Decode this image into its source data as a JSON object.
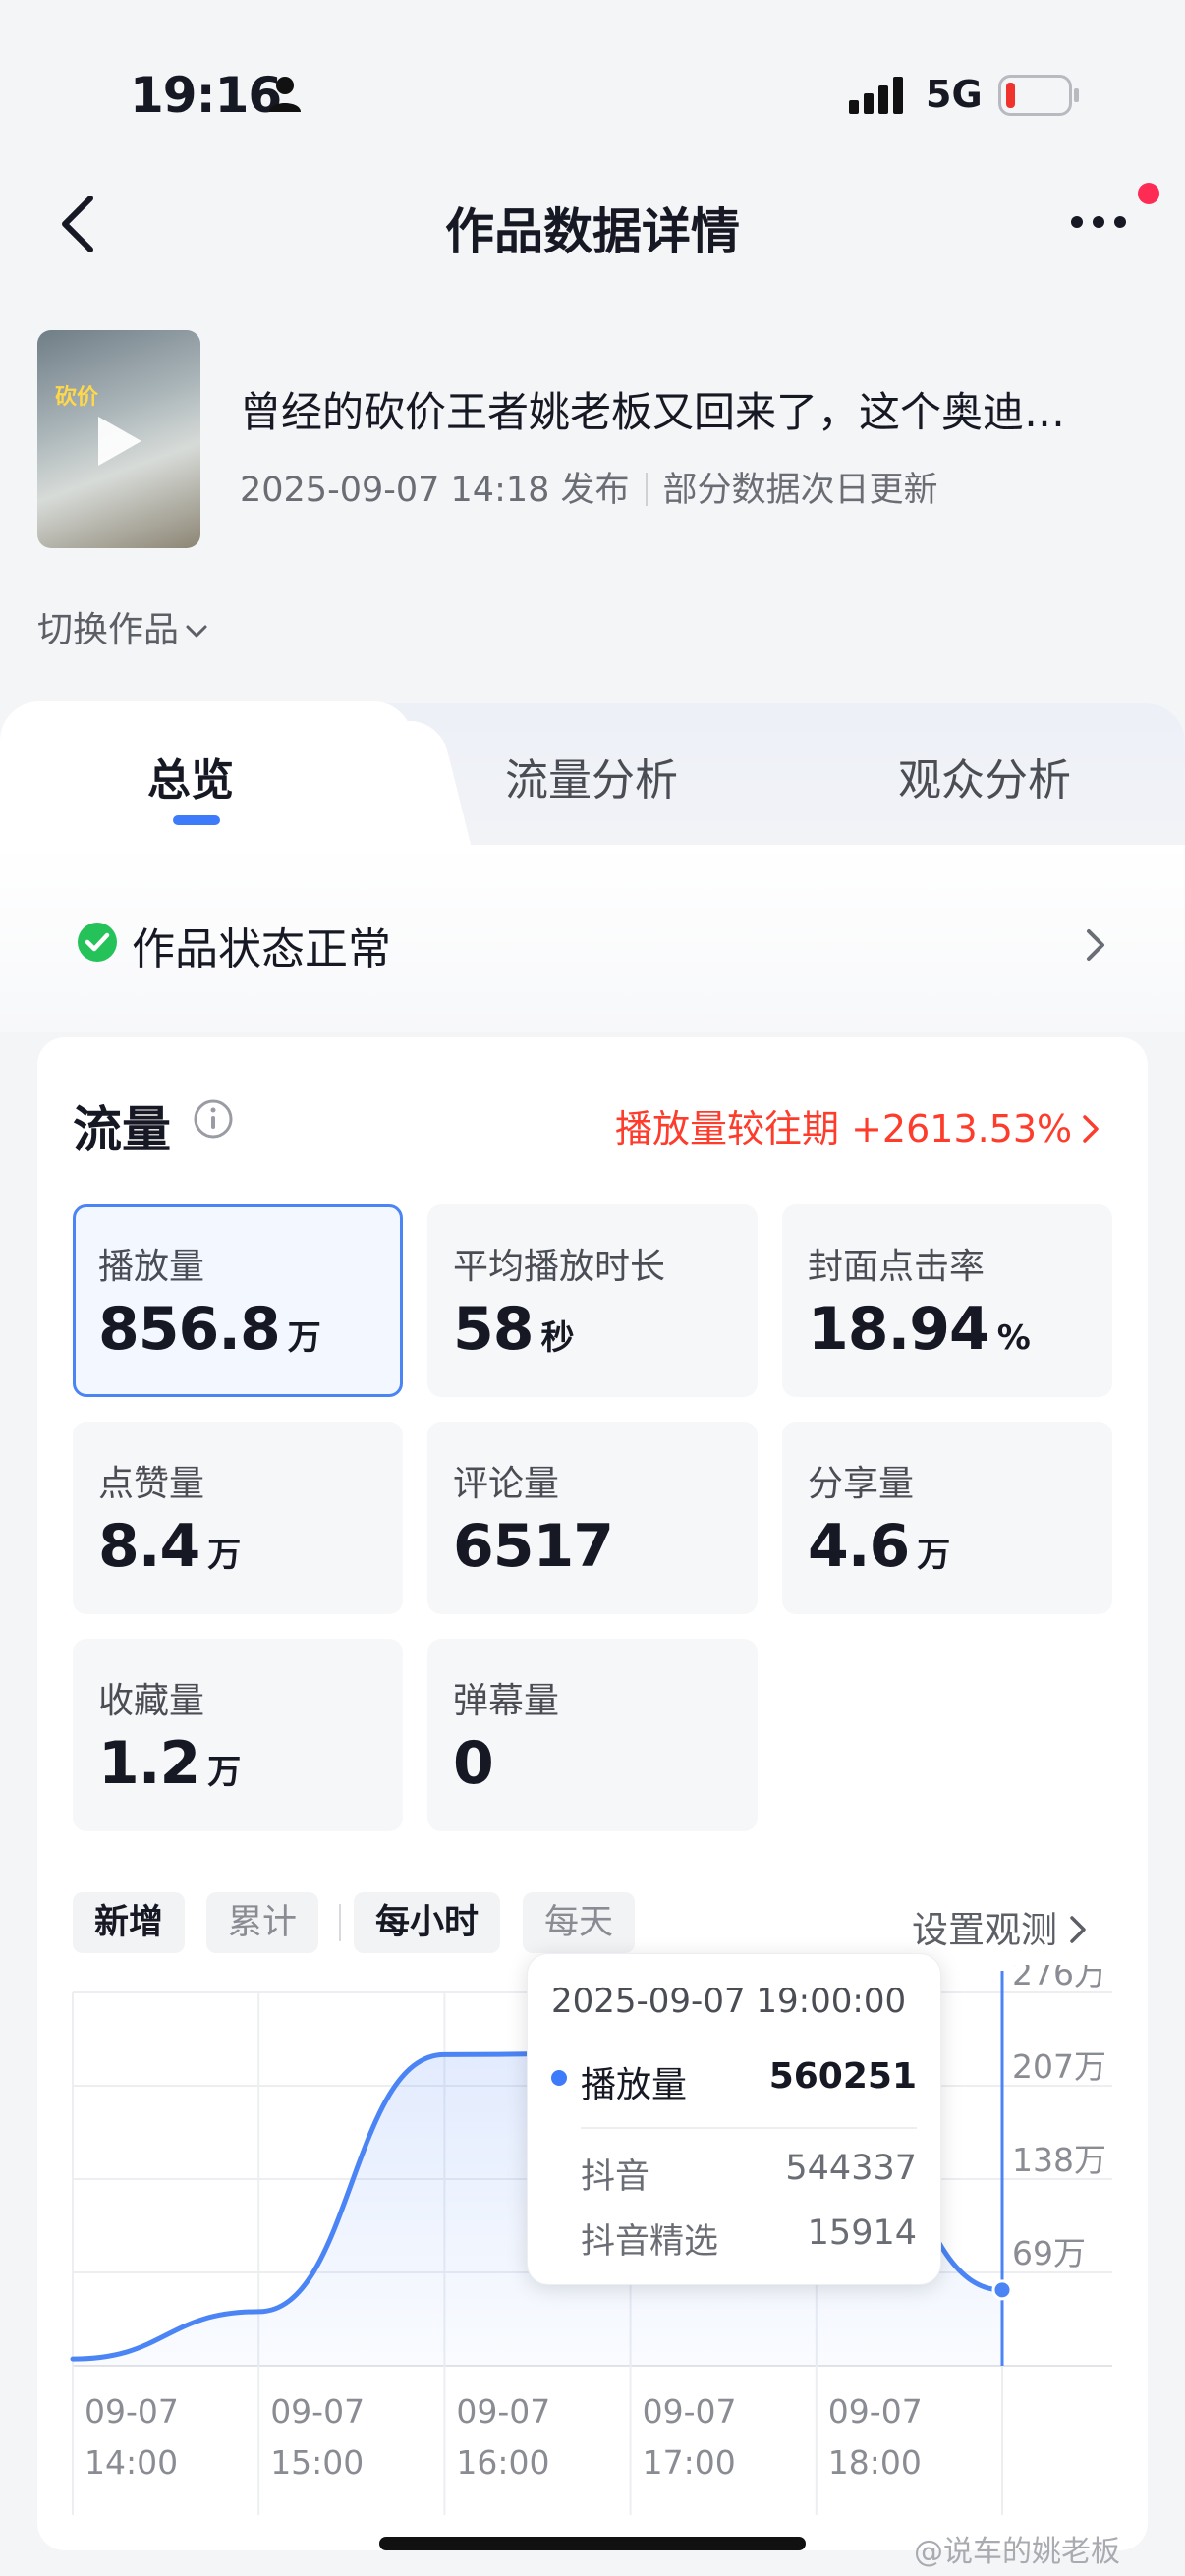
{
  "status_bar": {
    "time": "19:16",
    "network": "5G"
  },
  "nav": {
    "title": "作品数据详情"
  },
  "work": {
    "thumb_caption": "砍价",
    "title": "曾经的砍价王者姚老板又回来了，这个奥迪…",
    "publish_time": "2025-09-07 14:18 发布",
    "update_note": "部分数据次日更新",
    "switch_label": "切换作品"
  },
  "tabs": [
    {
      "label": "总览"
    },
    {
      "label": "流量分析"
    },
    {
      "label": "观众分析"
    }
  ],
  "status": {
    "label": "作品状态正常",
    "color": "#25c25a"
  },
  "flow": {
    "title": "流量",
    "compare": "播放量较往期 +2613.53%",
    "accent": "#fe3c2c"
  },
  "metrics": [
    {
      "label": "播放量",
      "value": "856.8",
      "unit": "万"
    },
    {
      "label": "平均播放时长",
      "value": "58",
      "unit": "秒"
    },
    {
      "label": "封面点击率",
      "value": "18.94",
      "unit": "%"
    },
    {
      "label": "点赞量",
      "value": "8.4",
      "unit": "万"
    },
    {
      "label": "评论量",
      "value": "6517",
      "unit": ""
    },
    {
      "label": "分享量",
      "value": "4.6",
      "unit": "万"
    },
    {
      "label": "收藏量",
      "value": "1.2",
      "unit": "万"
    },
    {
      "label": "弹幕量",
      "value": "0",
      "unit": ""
    }
  ],
  "chips": {
    "new": "新增",
    "cumulative": "累计",
    "hourly": "每小时",
    "daily": "每天"
  },
  "set_observe": "设置观测",
  "chart_data": {
    "type": "area",
    "x": [
      "09-07 14:00",
      "09-07 15:00",
      "09-07 16:00",
      "09-07 17:00",
      "09-07 18:00",
      "09-07 19:00"
    ],
    "x_tick_labels": [
      [
        "09-07",
        "14:00"
      ],
      [
        "09-07",
        "15:00"
      ],
      [
        "09-07",
        "16:00"
      ],
      [
        "09-07",
        "17:00"
      ],
      [
        "09-07",
        "18:00"
      ]
    ],
    "series": [
      {
        "values": [
          50000,
          400000,
          2300000,
          2310000,
          2200000,
          560251
        ],
        "color": "#4b84f5"
      }
    ],
    "y_tick_labels": [
      "276万",
      "207万",
      "138万",
      "69万"
    ],
    "y_ticks": [
      2760000,
      2070000,
      1380000,
      690000
    ],
    "ylim": [
      0,
      2760000
    ],
    "grid": true
  },
  "tooltip": {
    "date": "2025-09-07 19:00:00",
    "series_name": "播放量",
    "series_value": "560251",
    "rows": [
      {
        "name": "抖音",
        "value": "544337"
      },
      {
        "name": "抖音精选",
        "value": "15914"
      }
    ]
  },
  "watermark": "@说车的姚老板"
}
